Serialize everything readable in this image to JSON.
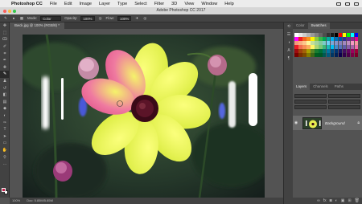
{
  "menubar": {
    "app": "Photoshop CC",
    "items": [
      "File",
      "Edit",
      "Image",
      "Layer",
      "Type",
      "Select",
      "Filter",
      "3D",
      "View",
      "Window",
      "Help"
    ]
  },
  "window": {
    "title": "Adobe Photoshop CC 2017"
  },
  "options": {
    "mode_label": "Mode:",
    "mode_value": "Color",
    "opacity_label": "Opacity:",
    "opacity_value": "100%",
    "flow_label": "Flow:",
    "flow_value": "100%"
  },
  "document": {
    "tab_title": "Bwck.jpg @ 100% (RGB/8) *",
    "zoom": "100%",
    "doc_info": "Doc: 5.85M/5.85M"
  },
  "panels": {
    "top_tabs": [
      "Color",
      "Swatches"
    ],
    "layers_tabs": [
      "Layers",
      "Channels",
      "Paths"
    ],
    "layer_name": "Background"
  },
  "colors": {
    "foreground": "#c31e4a",
    "background": "#ffffff",
    "selected_layer": "#6a6a6a"
  },
  "icons": {
    "tools": [
      "move-tool-icon",
      "marquee-tool-icon",
      "lasso-tool-icon",
      "quick-select-icon",
      "crop-tool-icon",
      "eyedropper-icon",
      "healing-brush-icon",
      "brush-tool-icon",
      "clone-stamp-icon",
      "history-brush-icon",
      "eraser-icon",
      "gradient-tool-icon",
      "blur-tool-icon",
      "dodge-tool-icon",
      "pen-tool-icon",
      "type-tool-icon",
      "path-select-icon",
      "shape-tool-icon",
      "hand-tool-icon",
      "zoom-tool-icon",
      "more-tools-icon"
    ]
  }
}
